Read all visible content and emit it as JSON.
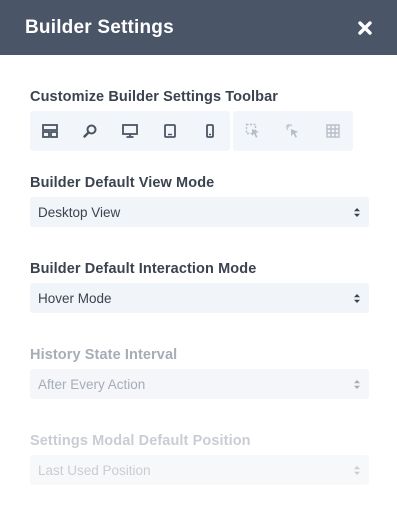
{
  "modal": {
    "title": "Builder Settings"
  },
  "toolbar": {
    "label": "Customize Builder Settings Toolbar",
    "primary_icons": [
      "layout-icon",
      "zoom-icon",
      "desktop-icon",
      "tablet-icon",
      "phone-icon"
    ],
    "secondary_icons": [
      "click-mode-icon",
      "hover-mode-icon",
      "grid-icon"
    ]
  },
  "settings": [
    {
      "label": "Builder Default View Mode",
      "value": "Desktop View",
      "state": "enabled"
    },
    {
      "label": "Builder Default Interaction Mode",
      "value": "Hover Mode",
      "state": "enabled"
    },
    {
      "label": "History State Interval",
      "value": "After Every Action",
      "state": "disabled"
    },
    {
      "label": "Settings Modal Default Position",
      "value": "Last Used Position",
      "state": "disabled"
    }
  ],
  "colors": {
    "header_bg": "#4a5568",
    "text": "#3b4350",
    "control_bg": "#f1f4f8",
    "icon": "#4b5563",
    "icon_muted": "#b8bec8"
  }
}
